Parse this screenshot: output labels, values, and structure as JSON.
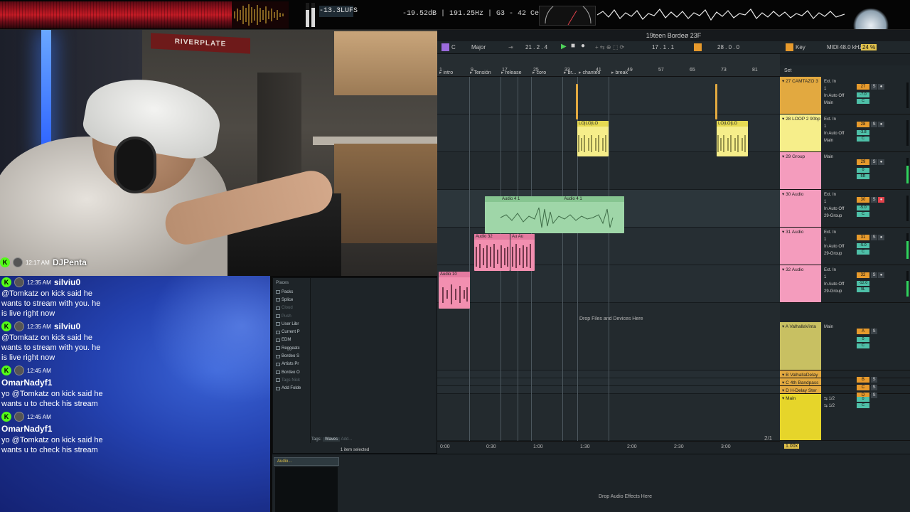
{
  "colors": {
    "clip_green": "#9fd6a8",
    "clip_pink": "#f28fb0",
    "track_orange": "#e2a940",
    "track_yellow": "#f6ee8a",
    "track_pink": "#f49cbd",
    "return_olive": "#c8c062",
    "return_orange": "#e2a940",
    "main_yellow": "#e6d52a",
    "kick_green": "#53fc18",
    "record_red": "#e3424b"
  },
  "top_meters": {
    "lufs": "-13.3LUFS",
    "readout": "-19.52dB | 191.25Hz | G3 - 42 Cents"
  },
  "webcam": {
    "banner_text": "RIVERPLATE",
    "username": "DJPenta",
    "time": "12:17 AM",
    "badge": "K"
  },
  "chat": {
    "messages": [
      {
        "time": "12:35 AM",
        "user": "silviu0",
        "text": "@Tomkatz on kick said he wants to stream with you. he is live right now"
      },
      {
        "time": "12:35 AM",
        "user": "silviu0",
        "text": "@Tomkatz on kick said he wants to stream with you. he is live right now"
      },
      {
        "time": "12:45 AM",
        "user": "OmarNadyf1",
        "text": "yo @Tomkatz on kick said he wants u to check his stream"
      },
      {
        "time": "12:45 AM",
        "user": "OmarNadyf1",
        "text": "yo @Tomkatz on kick said he wants u to check his stream"
      }
    ]
  },
  "ableton": {
    "title": "19teen Bordeø 23F",
    "transport": {
      "key": "C",
      "scale": "Major",
      "position": "21 .  2 .  4",
      "loop_start": "17 .  1 .  1",
      "loop_length": "28 .  0 .  0",
      "key_label": "Key",
      "midi_label": "MIDI",
      "sample_rate": "48.0 kHz",
      "cpu": "24 %"
    },
    "set_label": "Set",
    "ruler_numbers": [
      "1",
      "9",
      "17",
      "25",
      "33",
      "41",
      "49",
      "57",
      "65",
      "73",
      "81"
    ],
    "locators": [
      "intro",
      "Tensión",
      "release",
      "coro",
      "br...",
      "chanteo",
      "break"
    ],
    "clips": {
      "loop_labels": [
        "LO",
        "LO",
        "LO"
      ],
      "audio4_a": "Audio 4 1",
      "audio4_b": "Audio 4 1",
      "audio32_a": "Audio 32",
      "audio32_b": "Au",
      "audio32_c": "Au",
      "audio10": "Audio 10"
    },
    "drop_files": "Drop Files and Devices Here",
    "timeline": [
      "0:00",
      "0:30",
      "1:00",
      "1:30",
      "2:00",
      "2:30",
      "3:00"
    ],
    "page_indicator": "2/1",
    "zoom": "1.00x",
    "tracks": [
      {
        "name": "27 CAMTAZO 3",
        "input": "Ext. In",
        "ch": "1",
        "monitor": "In  Auto  Off",
        "out": "Main",
        "num": "27",
        "vol": "-7.0",
        "pan": "C",
        "meter": 0.0
      },
      {
        "name": "28 LOOP 2 90bp",
        "input": "Ext. In",
        "ch": "1",
        "monitor": "In  Auto  Off",
        "out": "Main",
        "num": "28",
        "vol": "-3.8",
        "pan": "C",
        "meter": 0.0
      },
      {
        "name": "29 Group",
        "input": "Main",
        "ch": "",
        "monitor": "",
        "out": "",
        "num": "29",
        "vol": "0",
        "pan": "5R",
        "meter": 0.7
      },
      {
        "name": "30 Audio",
        "input": "Ext. In",
        "ch": "1",
        "monitor": "In  Auto  Off",
        "out": "29-Group",
        "num": "30",
        "vol": "-5.0",
        "pan": "C",
        "meter": 0.0
      },
      {
        "name": "31 Audio",
        "input": "Ext. In",
        "ch": "1",
        "monitor": "In  Auto  Off",
        "out": "29-Group",
        "num": "31",
        "vol": "-5.0",
        "pan": "C",
        "meter": 0.7
      },
      {
        "name": "32 Audio",
        "input": "Ext. In",
        "ch": "1",
        "monitor": "In  Auto  Off",
        "out": "29-Group",
        "num": "32",
        "vol": "-12.0",
        "pan": "9L",
        "meter": 0.6
      }
    ],
    "returns": [
      {
        "name": "A ValhallaVinta",
        "out": "Main",
        "letter": "A",
        "vol": "0",
        "pan": "C"
      },
      {
        "name": "B ValhallaDelay",
        "letter": "B"
      },
      {
        "name": "C 4th Bandpass",
        "letter": "C"
      },
      {
        "name": "D H-Delay Ster",
        "letter": "D"
      }
    ],
    "main": {
      "name": "Main",
      "out1": "1/2",
      "out2": "1/2",
      "vol": "0",
      "pan": "C"
    }
  },
  "browser": {
    "places_label": "Places",
    "items": [
      "Packs",
      "Splice",
      "Cloud",
      "Push",
      "User Libr",
      "Current P",
      "EDM",
      "Reggeatc",
      "Bordeo S",
      "Artists Pr",
      "Bordeo O",
      "Tags Nick",
      "Add Folde"
    ],
    "dim_items": [
      2,
      3,
      11
    ],
    "tags_label": "Tags:",
    "tag": "Waves",
    "tag_add": "Add...",
    "status": "1 item selected"
  },
  "device": {
    "chip": "Audio...",
    "drop": "Drop Audio Effects Here"
  }
}
